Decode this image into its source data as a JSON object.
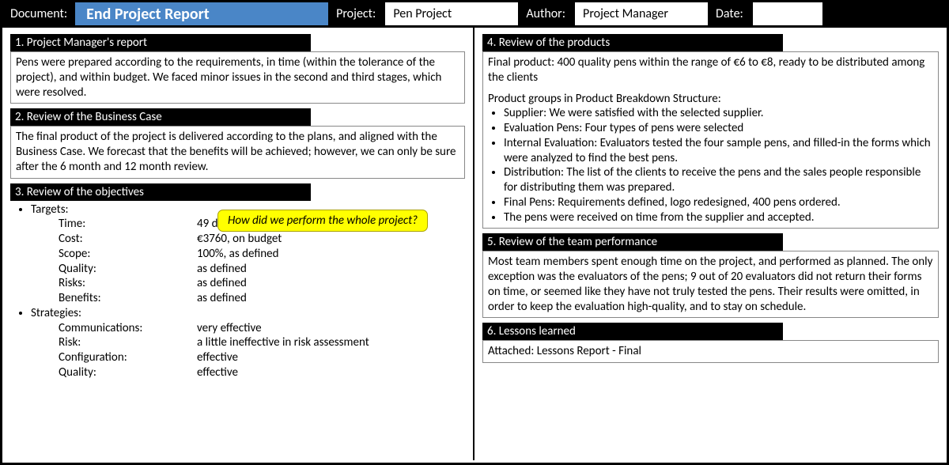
{
  "header": {
    "doc_label": "Document:",
    "doc_title": "End Project Report",
    "project_label": "Project:",
    "project_value": "Pen Project",
    "author_label": "Author:",
    "author_value": "Project Manager",
    "date_label": "Date:",
    "date_value": ""
  },
  "callout": "How did we perform the whole project?",
  "s1": {
    "title": "1. Project Manager's report",
    "text": "Pens were prepared according to the requirements, in time (within the tolerance of the project), and within budget. We faced minor issues in the second and third stages, which were resolved."
  },
  "s2": {
    "title": "2. Review of the Business Case",
    "text": "The final product of the project is delivered according to the plans, and aligned with the Business Case. We forecast that the benefits will be achieved; however, we can only be sure after the 6 month and 12 month review."
  },
  "s3": {
    "title": "3. Review of the objectives",
    "targets_label": "Targets:",
    "targets": [
      {
        "k": "Time:",
        "v": "49 days, within tolerance"
      },
      {
        "k": "Cost:",
        "v": "€3760, on budget"
      },
      {
        "k": "Scope:",
        "v": "100%, as defined"
      },
      {
        "k": "Quality:",
        "v": "as defined"
      },
      {
        "k": "Risks:",
        "v": "as defined"
      },
      {
        "k": "Benefits:",
        "v": "as defined"
      }
    ],
    "strategies_label": "Strategies:",
    "strategies": [
      {
        "k": "Communications:",
        "v": "very effective"
      },
      {
        "k": "Risk:",
        "v": "a little ineffective in risk assessment"
      },
      {
        "k": "Configuration:",
        "v": "effective"
      },
      {
        "k": "Quality:",
        "v": "effective"
      }
    ]
  },
  "s4": {
    "title": "4. Review of the products",
    "intro": "Final product: 400 quality pens within the range of €6 to €8, ready to be distributed among the clients",
    "groups_label": "Product groups in Product Breakdown Structure:",
    "items": [
      "Supplier: We were satisfied with the selected supplier.",
      "Evaluation Pens: Four types of pens were selected",
      "Internal Evaluation: Evaluators tested the four sample pens, and filled-in the forms which were analyzed to find the best pens.",
      "Distribution: The list of the clients to receive the pens and the sales people responsible for distributing them was prepared.",
      "Final Pens: Requirements defined, logo redesigned, 400 pens ordered.",
      "The pens were received on time from the supplier and accepted."
    ]
  },
  "s5": {
    "title": "5. Review of the team performance",
    "text": "Most team members spent enough time on the project, and performed as planned. The only exception was the evaluators of the pens; 9 out of 20 evaluators did not return their forms on time, or seemed like they have not truly tested the pens. Their results were omitted, in order to keep the evaluation high-quality, and to stay on schedule."
  },
  "s6": {
    "title": "6. Lessons learned",
    "text": "Attached: Lessons Report - Final"
  }
}
